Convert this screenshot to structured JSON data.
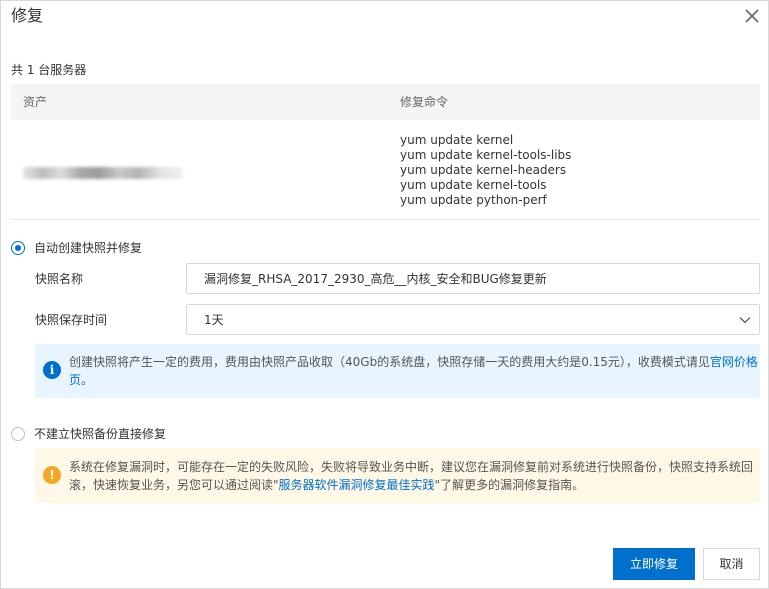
{
  "dialog": {
    "title": "修复",
    "close_icon": "close-icon"
  },
  "server_count": "共 1 台服务器",
  "table": {
    "headers": [
      "资产",
      "修复命令"
    ],
    "rows": [
      {
        "commands": [
          "yum update kernel",
          "yum update kernel-tools-libs",
          "yum update kernel-headers",
          "yum update kernel-tools",
          "yum update python-perf"
        ]
      }
    ]
  },
  "option_snapshot": {
    "label": "自动创建快照并修复",
    "selected": true,
    "name_label": "快照名称",
    "name_value": "漏洞修复_RHSA_2017_2930_高危__内核_安全和BUG修复更新",
    "retention_label": "快照保存时间",
    "retention_value": "1天",
    "info_text": "创建快照将产生一定的费用，费用由快照产品收取（40Gb的系统盘，快照存储一天的费用大约是0.15元），收费模式请见",
    "info_link": "官网价格页",
    "info_suffix": "。"
  },
  "option_direct": {
    "label": "不建立快照备份直接修复",
    "selected": false,
    "warn_text": "系统在修复漏洞时，可能存在一定的失败风险，失败将导致业务中断，建议您在漏洞修复前对系统进行快照备份，快照支持系统回滚，快速恢复业务，另您可以通过阅读\"",
    "warn_link": "服务器软件漏洞修复最佳实践",
    "warn_suffix": "\"了解更多的漏洞修复指南。"
  },
  "buttons": {
    "confirm": "立即修复",
    "cancel": "取消"
  },
  "colors": {
    "primary": "#0070cc",
    "info_bg": "#e8f4ff",
    "warn_bg": "#fff8e6",
    "warn_icon": "#f5a623"
  }
}
